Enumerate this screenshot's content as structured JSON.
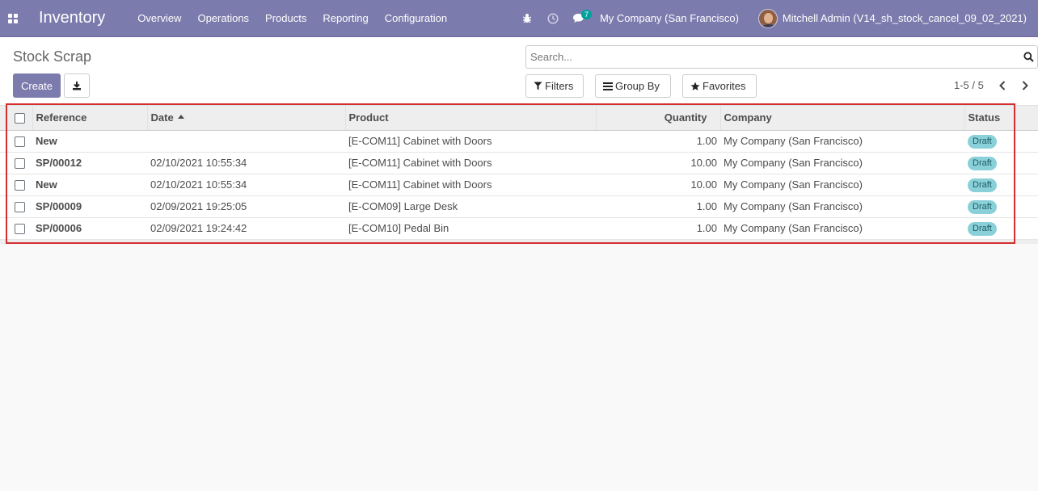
{
  "navbar": {
    "app_name": "Inventory",
    "menu": [
      "Overview",
      "Operations",
      "Products",
      "Reporting",
      "Configuration"
    ],
    "messages_count": "7",
    "company": "My Company (San Francisco)",
    "user": "Mitchell Admin (V14_sh_stock_cancel_09_02_2021)",
    "icons": [
      "apps-grid-icon",
      "bug-icon",
      "clock-icon",
      "chat-icon"
    ],
    "bar_color": "#7c7bad"
  },
  "control_panel": {
    "title": "Stock Scrap",
    "create_label": "Create",
    "search_placeholder": "Search...",
    "filters_label": "Filters",
    "group_by_label": "Group By",
    "favorites_label": "Favorites",
    "pager": "1-5 / 5"
  },
  "table": {
    "columns": [
      "Reference",
      "Date",
      "Product",
      "Quantity",
      "Company",
      "Status"
    ],
    "rows": [
      {
        "reference": "New",
        "date": "",
        "product": "[E-COM11] Cabinet with Doors",
        "quantity": "1.00",
        "company": "My Company (San Francisco)",
        "status": "Draft"
      },
      {
        "reference": "SP/00012",
        "date": "02/10/2021 10:55:34",
        "product": "[E-COM11] Cabinet with Doors",
        "quantity": "10.00",
        "company": "My Company (San Francisco)",
        "status": "Draft"
      },
      {
        "reference": "New",
        "date": "02/10/2021 10:55:34",
        "product": "[E-COM11] Cabinet with Doors",
        "quantity": "10.00",
        "company": "My Company (San Francisco)",
        "status": "Draft"
      },
      {
        "reference": "SP/00009",
        "date": "02/09/2021 19:25:05",
        "product": "[E-COM09] Large Desk",
        "quantity": "1.00",
        "company": "My Company (San Francisco)",
        "status": "Draft"
      },
      {
        "reference": "SP/00006",
        "date": "02/09/2021 19:24:42",
        "product": "[E-COM10] Pedal Bin",
        "quantity": "1.00",
        "company": "My Company (San Francisco)",
        "status": "Draft"
      }
    ]
  },
  "colors": {
    "accent": "#7c7bad",
    "status_badge": "#89d0d8",
    "highlight": "#d32f2f"
  }
}
